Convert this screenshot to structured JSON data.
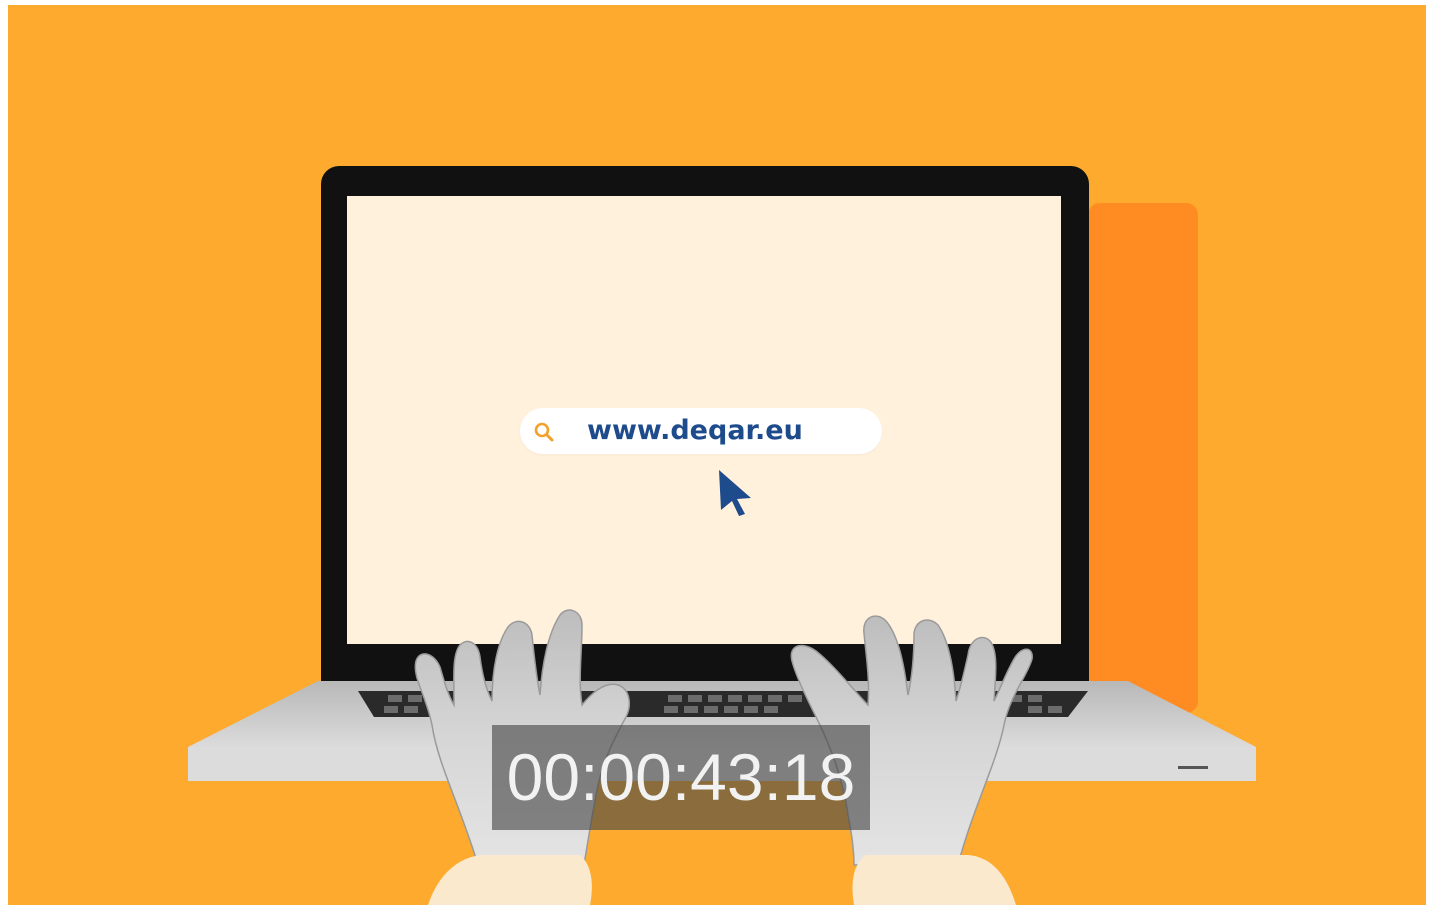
{
  "search": {
    "address_text": "www.deqar.eu",
    "icon": "search-icon"
  },
  "cursor": {
    "icon": "arrow-cursor-icon"
  },
  "overlay": {
    "timecode": "00:00:43:18"
  },
  "colors": {
    "background": "#FDAA2E",
    "shadow_panel": "#FE8C22",
    "screen": "#FFF1DC",
    "bezel": "#111111",
    "address_text": "#1E4B8C",
    "search_icon": "#F2A12A",
    "cursor": "#1E4B8C",
    "sleeve": "#FBE9CD",
    "laptop_base": "#C9C9C9"
  }
}
